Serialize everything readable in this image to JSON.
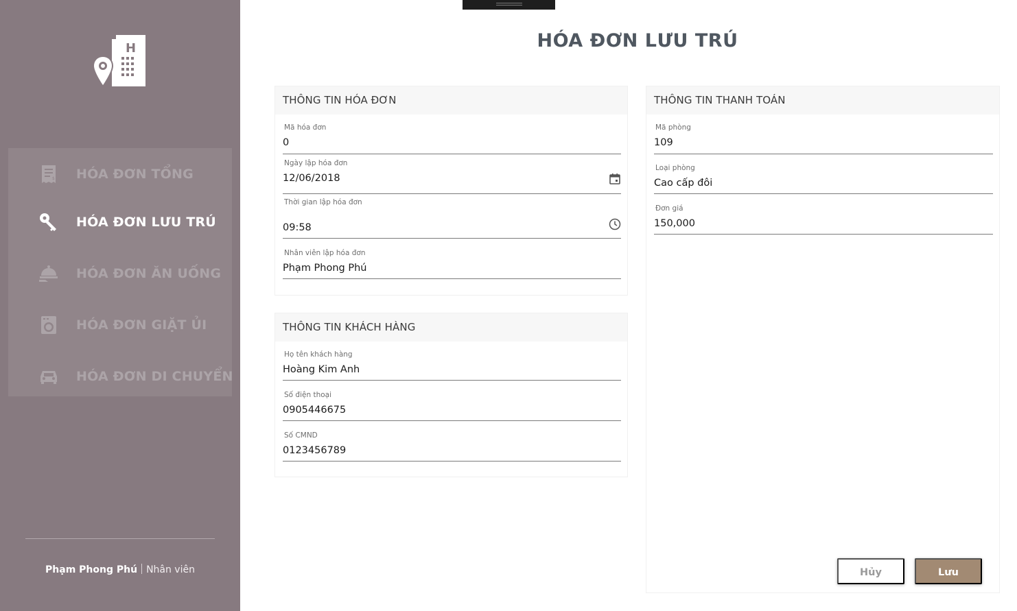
{
  "page": {
    "title": "HÓA ĐƠN LƯU TRÚ"
  },
  "sidebar": {
    "logo_icon": "hotel-location-icon",
    "items": [
      {
        "label": "HÓA ĐƠN TỔNG",
        "icon": "receipt-icon",
        "active": false
      },
      {
        "label": "HÓA ĐƠN LƯU TRÚ",
        "icon": "key-icon",
        "active": true
      },
      {
        "label": "HÓA ĐƠN ĂN UỐNG",
        "icon": "room-service-icon",
        "active": false
      },
      {
        "label": "HÓA ĐƠN GIẶT ỦI",
        "icon": "washing-machine-icon",
        "active": false
      },
      {
        "label": "HÓA ĐƠN DI CHUYỂN",
        "icon": "car-icon",
        "active": false
      }
    ],
    "user": {
      "name": "Phạm Phong Phú",
      "role": "Nhân viên"
    }
  },
  "invoice_info": {
    "title": "THÔNG TIN HÓA ĐƠN",
    "fields": [
      {
        "label": "Mã hóa đơn",
        "value": "0"
      },
      {
        "label": "Ngày lập hóa đơn",
        "value": "12/06/2018",
        "icon": "calendar-icon"
      },
      {
        "label": "Thời gian lập hóa đơn",
        "value": "09:58",
        "icon": "clock-icon"
      },
      {
        "label": "Nhân viên lập hóa đơn",
        "value": "Phạm Phong Phú"
      }
    ]
  },
  "customer_info": {
    "title": "THÔNG TIN KHÁCH HÀNG",
    "fields": [
      {
        "label": "Họ tên khách hàng",
        "value": "Hoàng Kim Anh"
      },
      {
        "label": "Số điện thoại",
        "value": "0905446675"
      },
      {
        "label": "Số CMND",
        "value": "0123456789"
      }
    ]
  },
  "payment_info": {
    "title": "THÔNG TIN THANH TOÁN",
    "fields": [
      {
        "label": "Mã phòng",
        "value": "109"
      },
      {
        "label": "Loại phòng",
        "value": "Cao cấp đôi"
      },
      {
        "label": "Đơn giá",
        "value": "150,000"
      }
    ]
  },
  "actions": {
    "cancel_label": "Hủy",
    "save_label": "Lưu"
  },
  "colors": {
    "sidebar_bg": "#877a80",
    "nav_bg": "#91858a",
    "accent": "#a28a73",
    "title": "#4f5760"
  }
}
